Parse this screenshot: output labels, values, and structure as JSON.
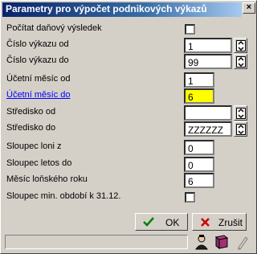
{
  "window": {
    "title": "Parametry pro výpočet podnikových výkazů",
    "close_glyph": "×"
  },
  "form": {
    "rows": [
      {
        "label": "Počítat daňový výsledek",
        "type": "checkbox",
        "checked": false
      },
      {
        "label": "Číslo výkazu od",
        "type": "text",
        "value": "1",
        "lookup": true
      },
      {
        "label": "Číslo výkazu do",
        "type": "text",
        "value": "99",
        "lookup": true
      },
      {
        "label": "Účetní měsíc od",
        "type": "text",
        "value": "1"
      },
      {
        "label": "Účetní měsíc do",
        "type": "text",
        "value": "6",
        "focused": true
      },
      {
        "label": "Středisko od",
        "type": "text",
        "value": "",
        "lookup": true
      },
      {
        "label": "Středisko do",
        "type": "text",
        "value": "ZZZZZZ",
        "lookup": true
      },
      {
        "label": "Sloupec loni z",
        "type": "text",
        "value": "0"
      },
      {
        "label": "Sloupec letos do",
        "type": "text",
        "value": "0"
      },
      {
        "label": "Měsíc loňského roku",
        "type": "text",
        "value": "6"
      },
      {
        "label": "Sloupec min. období k 31.12.",
        "type": "checkbox",
        "checked": false
      }
    ]
  },
  "buttons": {
    "ok_label": "OK",
    "cancel_label": "Zrušit"
  },
  "colors": {
    "focus_label": "#0000ff",
    "focus_field": "#ffff00",
    "ok_check": "#008000",
    "cancel_x": "#cc0000"
  },
  "toolbar": {
    "icons": [
      "help-person-icon",
      "book-icon",
      "pencil-icon"
    ]
  }
}
